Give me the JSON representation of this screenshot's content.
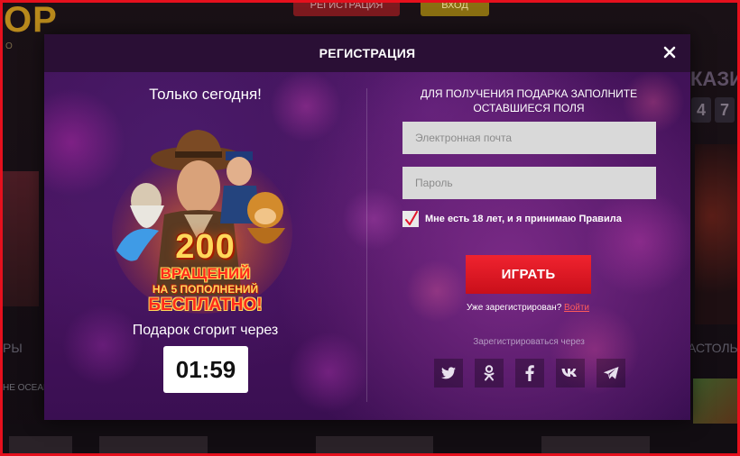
{
  "background": {
    "logo_text": "OP",
    "logo_sub": "O",
    "top_button_1": "РЕГИСТРАЦИЯ",
    "top_button_2": "ВХОД",
    "left_label": "РЫ",
    "left_ocean": "HE OCEAN",
    "right_heading": "КАЗИ",
    "right_digits": [
      "4",
      "7"
    ],
    "right_label": "АСТОЛЬН"
  },
  "modal": {
    "title": "РЕГИСТРАЦИЯ",
    "close_icon": "close-icon",
    "promo": {
      "top_text": "Только сегодня!",
      "number": "200",
      "line1": "ВРАЩЕНИЙ",
      "line2": "НА 5 ПОПОЛНЕНИЙ",
      "line3": "БЕСПЛАТНО!",
      "gift_label": "Подарок сгорит через",
      "timer": "01:59"
    },
    "form": {
      "heading": "ДЛЯ ПОЛУЧЕНИЯ ПОДАРКА ЗАПОЛНИТЕ ОСТАВШИЕСЯ ПОЛЯ",
      "email_placeholder": "Электронная почта",
      "password_placeholder": "Пароль",
      "terms_checked": true,
      "terms_label": "Мне есть 18 лет, и я принимаю Правила",
      "play_button": "ИГРАТЬ",
      "already_registered": "Уже зарегистрирован?",
      "login_link": "Войти",
      "register_via": "Зарегистрироваться через",
      "socials": [
        {
          "name": "twitter-icon"
        },
        {
          "name": "odnoklassniki-icon"
        },
        {
          "name": "facebook-icon"
        },
        {
          "name": "vk-icon"
        },
        {
          "name": "telegram-icon"
        }
      ]
    }
  },
  "colors": {
    "accent_red": "#e5101d",
    "button_red": "#f0232f",
    "modal_purple": "#4a1461",
    "header_dark": "#2a0f35"
  }
}
